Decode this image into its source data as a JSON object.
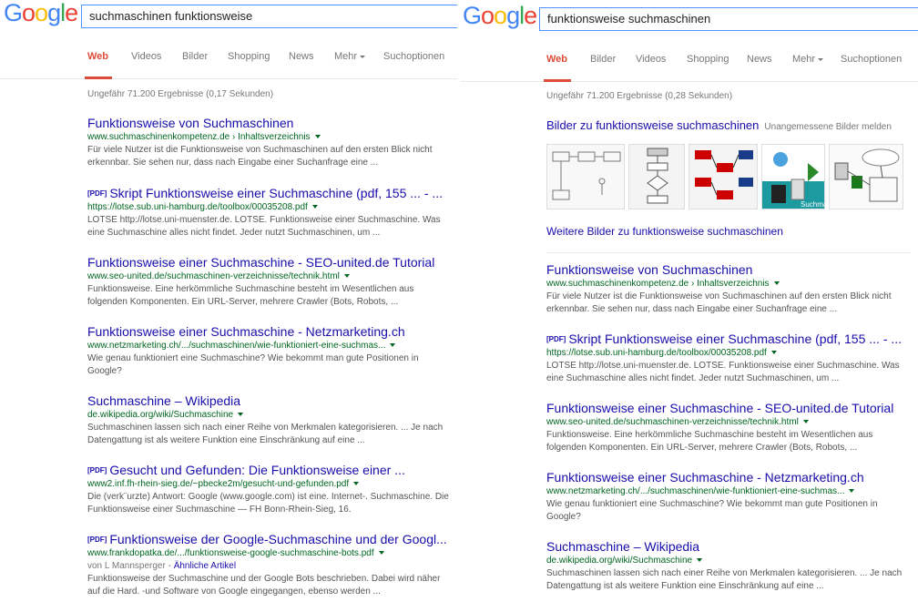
{
  "logo": {
    "letters": [
      "G",
      "o",
      "o",
      "g",
      "l",
      "e"
    ],
    "colors": [
      "#4285f4",
      "#ea4335",
      "#fbbc05",
      "#4285f4",
      "#34a853",
      "#ea4335"
    ]
  },
  "left": {
    "query": "suchmaschinen funktionsweise",
    "tabs": [
      {
        "label": "Web",
        "active": true
      },
      {
        "label": "Videos"
      },
      {
        "label": "Bilder"
      },
      {
        "label": "Shopping"
      },
      {
        "label": "News"
      },
      {
        "label": "Mehr"
      },
      {
        "label": "Suchoptionen"
      }
    ],
    "stats": "Ungefähr 71.200 Ergebnisse (0,17 Sekunden)",
    "results": [
      {
        "pdf": "",
        "title": "Funktionsweise von Suchmaschinen",
        "url": "www.suchmaschinenkompetenz.de › Inhaltsverzeichnis",
        "snippet": "Für viele Nutzer ist die Funktionsweise von Suchmaschinen auf den ersten Blick nicht erkennbar. Sie sehen nur, dass nach Eingabe einer Suchanfrage eine ..."
      },
      {
        "pdf": "[PDF]",
        "title": "Skript Funktionsweise einer Suchmaschine (pdf, 155 ... - ...",
        "url": "https://lotse.sub.uni-hamburg.de/toolbox/00035208.pdf",
        "snippet": "LOTSE http://lotse.uni-muenster.de. LOTSE. Funktionsweise einer Suchmaschine. Was eine Suchmaschine alles nicht findet. Jeder nutzt Suchmaschinen, um ..."
      },
      {
        "pdf": "",
        "title": "Funktionsweise einer Suchmaschine - SEO-united.de Tutorial",
        "url": "www.seo-united.de/suchmaschinen-verzeichnisse/technik.html",
        "snippet": "Funktionsweise. Eine herkömmliche Suchmaschine besteht im Wesentlichen aus folgenden Komponenten. Ein URL-Server, mehrere Crawler (Bots, Robots, ..."
      },
      {
        "pdf": "",
        "title": "Funktionsweise einer Suchmaschine - Netzmarketing.ch",
        "url": "www.netzmarketing.ch/.../suchmaschinen/wie-funktioniert-eine-suchmas...",
        "snippet": "Wie genau funktioniert eine Suchmaschine? Wie bekommt man gute Positionen in Google?"
      },
      {
        "pdf": "",
        "title": "Suchmaschine – Wikipedia",
        "url": "de.wikipedia.org/wiki/Suchmaschine",
        "snippet": "Suchmaschinen lassen sich nach einer Reihe von Merkmalen kategorisieren. ... Je nach Datengattung ist als weitere Funktion eine Einschränkung auf eine ..."
      },
      {
        "pdf": "[PDF]",
        "title": "Gesucht und Gefunden: Die Funktionsweise einer ...",
        "url": "www2.inf.fh-rhein-sieg.de/~pbecke2m/gesucht-und-gefunden.pdf",
        "snippet": "Die (verk¨urzte) Antwort: Google (www.google.com) ist eine. Internet-. Suchmaschine. Die Funktionsweise einer Suchmaschine — FH Bonn-Rhein-Sieg, 16."
      },
      {
        "pdf": "[PDF]",
        "title": "Funktionsweise der Google-Suchmaschine und der Googl...",
        "url": "www.frankdopatka.de/.../funktionsweise-google-suchmaschine-bots.pdf",
        "author": "von L Mannsperger - ",
        "author_link": "Ähnliche Artikel",
        "snippet": "Funktionsweise der Suchmaschine und der Google Bots beschrieben. Dabei wird näher auf die Hard. -und Software von Google eingegangen, ebenso werden ..."
      }
    ]
  },
  "right": {
    "query": "funktionsweise suchmaschinen",
    "tabs": [
      {
        "label": "Web",
        "active": true
      },
      {
        "label": "Bilder"
      },
      {
        "label": "Videos"
      },
      {
        "label": "Shopping"
      },
      {
        "label": "News"
      },
      {
        "label": "Mehr"
      },
      {
        "label": "Suchoptionen"
      }
    ],
    "stats": "Ungefähr 71.200 Ergebnisse (0,28 Sekunden)",
    "images_header": "Bilder zu funktionsweise suchmaschinen",
    "images_flag": "Unangemessene Bilder melden",
    "images_more": "Weitere Bilder zu funktionsweise suchmaschinen",
    "image_caption": "Suchmas",
    "results": [
      {
        "pdf": "",
        "title": "Funktionsweise von Suchmaschinen",
        "url": "www.suchmaschinenkompetenz.de › Inhaltsverzeichnis",
        "snippet": "Für viele Nutzer ist die Funktionsweise von Suchmaschinen auf den ersten Blick nicht erkennbar. Sie sehen nur, dass nach Eingabe einer Suchanfrage eine ..."
      },
      {
        "pdf": "[PDF]",
        "title": "Skript Funktionsweise einer Suchmaschine (pdf, 155 ... - ...",
        "url": "https://lotse.sub.uni-hamburg.de/toolbox/00035208.pdf",
        "snippet": "LOTSE http://lotse.uni-muenster.de. LOTSE. Funktionsweise einer Suchmaschine. Was eine Suchmaschine alles nicht findet. Jeder nutzt Suchmaschinen, um ..."
      },
      {
        "pdf": "",
        "title": "Funktionsweise einer Suchmaschine - SEO-united.de Tutorial",
        "url": "www.seo-united.de/suchmaschinen-verzeichnisse/technik.html",
        "snippet": "Funktionsweise. Eine herkömmliche Suchmaschine besteht im Wesentlichen aus folgenden Komponenten. Ein URL-Server, mehrere Crawler (Bots, Robots, ..."
      },
      {
        "pdf": "",
        "title": "Funktionsweise einer Suchmaschine - Netzmarketing.ch",
        "url": "www.netzmarketing.ch/.../suchmaschinen/wie-funktioniert-eine-suchmas...",
        "snippet": "Wie genau funktioniert eine Suchmaschine? Wie bekommt man gute Positionen in Google?"
      },
      {
        "pdf": "",
        "title": "Suchmaschine – Wikipedia",
        "url": "de.wikipedia.org/wiki/Suchmaschine",
        "snippet": "Suchmaschinen lassen sich nach einer Reihe von Merkmalen kategorisieren. ... Je nach Datengattung ist als weitere Funktion eine Einschränkung auf eine ..."
      }
    ]
  }
}
